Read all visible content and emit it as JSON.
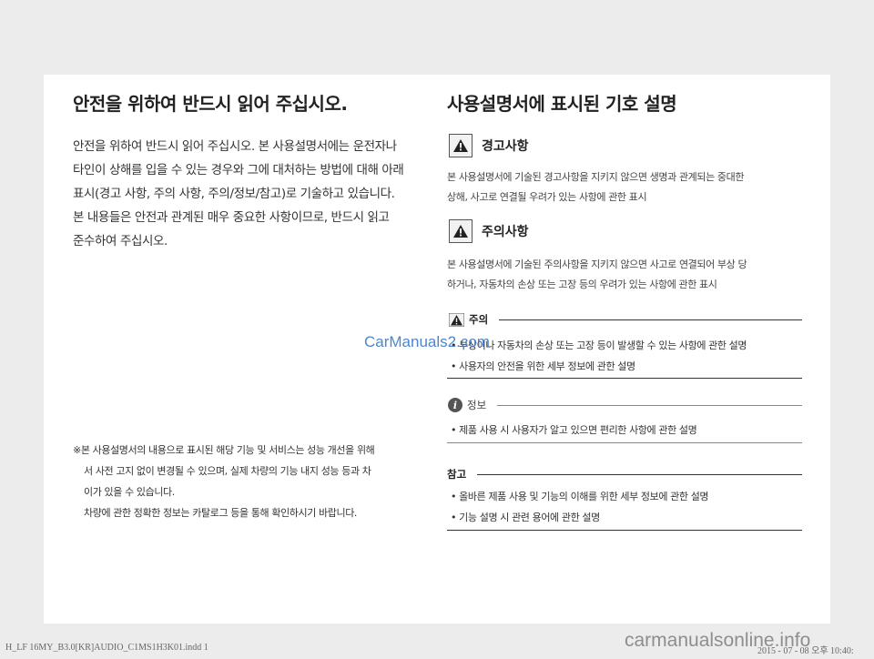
{
  "left": {
    "title": "안전을 위하여 반드시 읽어 주십시오.",
    "paragraph_lines": [
      "안전을 위하여 반드시 읽어 주십시오. 본 사용설명서에는 운전자나",
      "타인이 상해를 입을 수 있는 경우와 그에 대처하는 방법에 대해 아래",
      "표시(경고 사항, 주의 사항, 주의/정보/참고)로 기술하고 있습니다.",
      "본 내용들은 안전과 관계된 매우 중요한 사항이므로, 반드시 읽고",
      "준수하여 주십시오."
    ],
    "note_lines": [
      "※본 사용설명서의 내용으로 표시된 해당 기능 및 서비스는 성능 개선을 위해",
      "서 사전 고지 없이 변경될 수 있으며, 실제 차량의 기능 내지 성능 등과 차",
      "이가 있을 수 있습니다.",
      "차량에 관한 정확한 정보는 카탈로그 등을 통해 확인하시기 바랍니다."
    ]
  },
  "right": {
    "title": "사용설명서에 표시된 기호 설명",
    "warning": {
      "title": "경고사항",
      "icon": "warning-triangle-icon",
      "lines": [
        "본 사용설명서에 기술된 경고사항을 지키지 않으면 생명과 관계되는 중대한",
        "상해, 사고로 연결될 우려가 있는 사항에 관한 표시"
      ]
    },
    "caution": {
      "title": "주의사항",
      "icon": "warning-triangle-icon",
      "lines": [
        "본 사용설명서에 기술된 주의사항을 지키지 않으면 사고로 연결되어 부상 당",
        "하거나, 자동차의 손상 또는 고장 등의 우려가 있는 사항에 관한 표시"
      ]
    },
    "notice": {
      "label": "주의",
      "bullets": [
        "• 부상이나 자동차의 손상 또는 고장 등이 발생할 수 있는 사항에 관한 설명",
        "• 사용자의 안전을 위한 세부 정보에 관한 설명"
      ]
    },
    "info": {
      "label": "정보",
      "icon_glyph": "i",
      "bullets": [
        "• 제품 사용 시 사용자가 알고 있으면 편리한 사항에 관한 설명"
      ]
    },
    "reference": {
      "label": "참고",
      "bullets": [
        "• 올바른 제품 사용 및 기능의 이해를 위한 세부 정보에 관한 설명",
        "• 기능 설명 시 관련 용어에 관한 설명"
      ]
    }
  },
  "watermark": "CarManuals2.com",
  "footer": {
    "file": "H_LF 16MY_B3.0[KR]AUDIO_C1MS1H3K01.indd   1",
    "date": "2015 - 07 - 08   오후 10:40:",
    "site": "carmanualsonline.info"
  },
  "colors": {
    "background": "#ececec",
    "page": "#ffffff",
    "watermark": "#3a79c8"
  }
}
